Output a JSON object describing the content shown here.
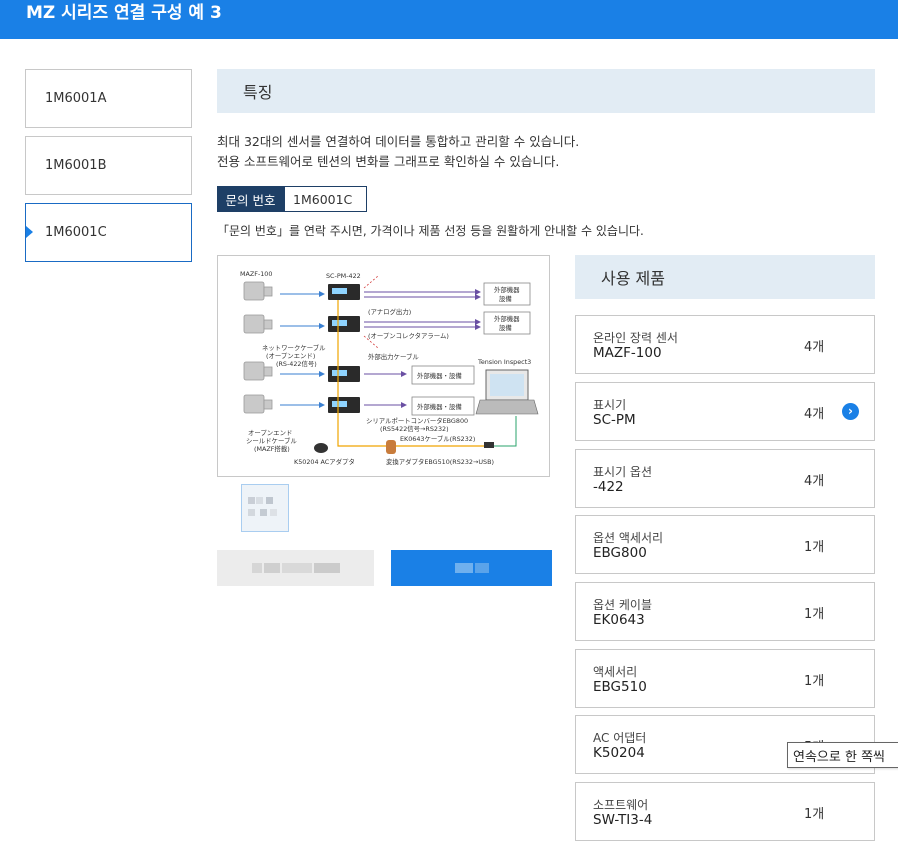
{
  "header": {
    "title": "MZ 시리즈 연결 구성 예 3"
  },
  "sidebar": {
    "items": [
      {
        "label": "1M6001A"
      },
      {
        "label": "1M6001B"
      },
      {
        "label": "1M6001C"
      }
    ]
  },
  "features": {
    "title": "특징",
    "lines": [
      "최대 32대의 센서를 연결하여 데이터를 통합하고 관리할 수 있습니다.",
      "전용 소프트웨어로 텐션의 변화를 그래프로 확인하실 수 있습니다."
    ]
  },
  "inquiry": {
    "label": "문의 번호",
    "value": "1M6001C",
    "note": "「문의 번호」를 연락 주시면, 가격이나 제품 선정 등을 원활하게 안내할 수 있습니다."
  },
  "diagram": {
    "labels": {
      "mazf": "MAZF-100",
      "scpm": "SC-PM-422",
      "analog": "(アナログ出力)",
      "open_collector": "(オープンコレクタアラーム)",
      "network_cable_1": "ネットワークケーブル",
      "network_cable_2": "(オープンエンド)",
      "network_cable_3": "(RS-422信号)",
      "ext_out": "外部出力ケーブル",
      "tension": "Tension Inspect3",
      "ext_dev_1": "外部機器",
      "ext_dev_2": "設備",
      "ext_dev_inline": "外部機器・設備",
      "serial_1": "シリアルポートコンバータEBG800",
      "serial_2": "(RS5422信号→RS232)",
      "ek": "EK0643ケーブル(RS232)",
      "open_end_1": "オープンエンド",
      "open_end_2": "シールドケーブル",
      "open_end_3": "(MAZF搭載)",
      "ac": "K50204 ACアダプタ",
      "conv": "変換アダプタEBG510(RS232→USB)"
    }
  },
  "products": {
    "title": "사용 제품",
    "items": [
      {
        "category": "온라인 장력 센서",
        "code": "MAZF-100",
        "qty": "4개"
      },
      {
        "category": "표시기",
        "code": "SC-PM",
        "qty": "4개",
        "link": true
      },
      {
        "category": "표시기 옵션",
        "code": "-422",
        "qty": "4개"
      },
      {
        "category": "옵션 액세서리",
        "code": "EBG800",
        "qty": "1개"
      },
      {
        "category": "옵션 케이블",
        "code": "EK0643",
        "qty": "1개"
      },
      {
        "category": "액세서리",
        "code": "EBG510",
        "qty": "1개"
      },
      {
        "category": "AC 어댑터",
        "code": "K50204",
        "qty": "5개"
      },
      {
        "category": "소프트웨어",
        "code": "SW-TI3-4",
        "qty": "1개"
      }
    ]
  },
  "tooltip": {
    "text": "연속으로 한 쪽씩"
  },
  "colors": {
    "accent": "#1a80e6",
    "navy": "#1e3f66",
    "panel": "#e2ecf4"
  }
}
